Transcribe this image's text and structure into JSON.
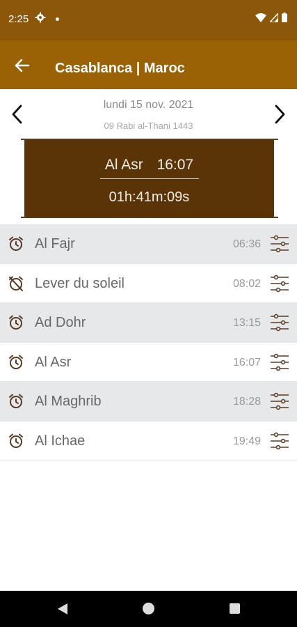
{
  "status_bar": {
    "time": "2:25"
  },
  "app_bar": {
    "title": "Casablanca | Maroc"
  },
  "date_nav": {
    "gregorian": "lundi 15 nov. 2021",
    "hijri": "09 Rabi al-Thani 1443"
  },
  "current": {
    "prayer": "Al Asr",
    "time": "16:07",
    "countdown": "01h:41m:09s"
  },
  "prayers": [
    {
      "name": "Al Fajr",
      "time": "06:36",
      "alarm_icon": "alarm-icon"
    },
    {
      "name": "Lever du soleil",
      "time": "08:02",
      "alarm_icon": "alarm-off-icon"
    },
    {
      "name": "Ad Dohr",
      "time": "13:15",
      "alarm_icon": "alarm-icon"
    },
    {
      "name": "Al Asr",
      "time": "16:07",
      "alarm_icon": "alarm-icon"
    },
    {
      "name": "Al Maghrib",
      "time": "18:28",
      "alarm_icon": "alarm-icon"
    },
    {
      "name": "Al Ichae",
      "time": "19:49",
      "alarm_icon": "alarm-icon"
    }
  ],
  "colors": {
    "status_bar": "#8c5708",
    "app_bar": "#9a6105",
    "current_box": "#5a3407",
    "row_shaded": "#e7e8ea",
    "icon": "#5a3b25"
  }
}
